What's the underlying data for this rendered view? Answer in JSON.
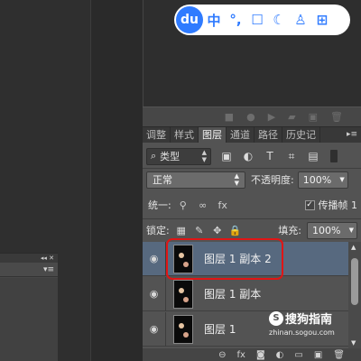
{
  "ime": {
    "logo": "du",
    "items": [
      {
        "name": "chinese-mode",
        "glyph": "中"
      },
      {
        "name": "punctuation",
        "glyph": "°,"
      },
      {
        "name": "skin",
        "glyph": "☐"
      },
      {
        "name": "night-mode",
        "glyph": "☾"
      },
      {
        "name": "user",
        "glyph": "♙"
      },
      {
        "name": "grid-menu",
        "glyph": "⊞"
      }
    ]
  },
  "panel_buttons": [
    "■",
    "●",
    "▶",
    "▰",
    "▣",
    "🗑"
  ],
  "tabs": [
    {
      "label": "调整",
      "active": false
    },
    {
      "label": "样式",
      "active": false
    },
    {
      "label": "图层",
      "active": true
    },
    {
      "label": "通道",
      "active": false
    },
    {
      "label": "路径",
      "active": false
    },
    {
      "label": "历史记",
      "active": false
    }
  ],
  "tab_menu": "▸≡",
  "filter": {
    "search_glyph": "⌕",
    "label": "类型",
    "icons": [
      "▣",
      "◐",
      "T",
      "⌗",
      "▤"
    ]
  },
  "blend": {
    "mode": "正常",
    "opacity_label": "不透明度:",
    "opacity_value": "100%"
  },
  "unify": {
    "label": "统一:",
    "icons": [
      "⚲",
      "∞",
      "fx"
    ],
    "propagate_label": "传播帧 1",
    "propagate_checked": "✓"
  },
  "lock": {
    "label": "锁定:",
    "icons": [
      "▦",
      "✎",
      "✥",
      "🔒"
    ],
    "fill_label": "填充:",
    "fill_value": "100%"
  },
  "layers": [
    {
      "name": "图层 1 副本 2",
      "selected": true
    },
    {
      "name": "图层 1 副本",
      "selected": false
    },
    {
      "name": "图层 1",
      "selected": false
    }
  ],
  "eye_glyph": "◉",
  "bottom_icons": [
    "⊖",
    "fx",
    "◙",
    "◐",
    "▭",
    "▣",
    "🗑"
  ],
  "float_panel": {
    "head_glyphs": "◂◂ ✕",
    "menu_glyph": "▾≡"
  },
  "watermark": {
    "title": "搜狗指南",
    "logo": "S",
    "url": "zhinan.sogou.com"
  },
  "colors": {
    "ime_blue": "#2f7bff",
    "highlight_red": "#e01515",
    "selected_row": "#57697f"
  }
}
